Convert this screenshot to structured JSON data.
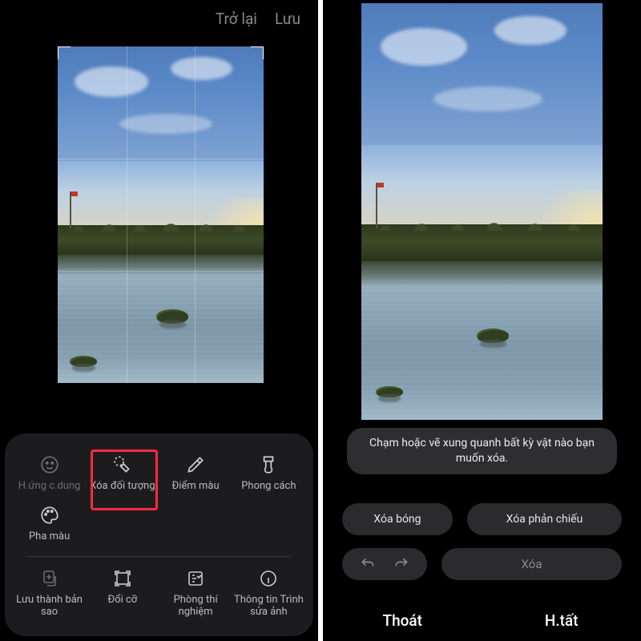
{
  "left": {
    "header": {
      "back": "Trở lại",
      "save": "Lưu"
    },
    "tools": [
      {
        "id": "portrait-effect",
        "label": "H.ứng c.dung",
        "dim": true
      },
      {
        "id": "remove-object",
        "label": "Xóa đối tượng",
        "highlight": true
      },
      {
        "id": "color-point",
        "label": "Điểm màu"
      },
      {
        "id": "style",
        "label": "Phong cách"
      },
      {
        "id": "color-mix",
        "label": "Pha màu"
      }
    ],
    "bottom": [
      {
        "id": "save-copy",
        "label": "Lưu thành bản sao",
        "dim": true
      },
      {
        "id": "resize",
        "label": "Đổi cỡ"
      },
      {
        "id": "lab",
        "label": "Phòng thí nghiệm"
      },
      {
        "id": "info",
        "label": "Thông tin Trình sửa ảnh"
      }
    ]
  },
  "right": {
    "hint": "Chạm hoặc vẽ xung quanh bất kỳ vật nào bạn muốn xóa.",
    "actions": {
      "shadow": "Xóa bóng",
      "reflection": "Xóa phản chiếu"
    },
    "delete": "Xóa",
    "footer": {
      "exit": "Thoát",
      "done": "H.tất"
    }
  }
}
